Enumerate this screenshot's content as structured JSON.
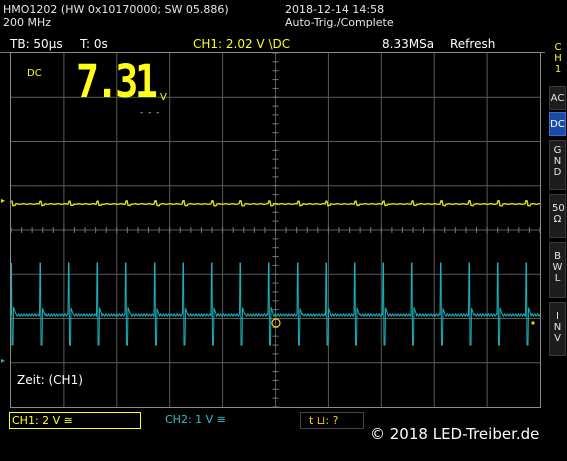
{
  "header": {
    "model": "HMO1202 (HW 0x10170000; SW 05.886)",
    "bandwidth": "200 MHz",
    "datetime": "2018-12-14 14:58",
    "trigger_status": "Auto-Trig./Complete"
  },
  "topbar": {
    "timebase": "TB: 50µs",
    "trigger_time": "T: 0s",
    "trigger_setting": "CH1: 2.02 V \\DC",
    "sample_rate": "8.33MSa",
    "mode": "Refresh"
  },
  "measurement": {
    "coupling": "DC",
    "value": "7.31",
    "unit": "V",
    "dashes": "- - -"
  },
  "screen_label": "Zeit: (CH1)",
  "channels": {
    "ch1": "CH1: 2 V ≅",
    "ch2": "CH2: 1 V ≅",
    "trig": "t ⊔: ?"
  },
  "copyright": "© 2018 LED-Treiber.de",
  "sidebar": {
    "title": "CH 1",
    "buttons": [
      {
        "label": "AC",
        "selected": false
      },
      {
        "label": "DC",
        "selected": true
      },
      {
        "label": "G N D",
        "selected": false
      },
      {
        "label": "50 Ω",
        "selected": false
      },
      {
        "label": "B W L",
        "selected": false
      },
      {
        "label": "I N V",
        "selected": false
      }
    ]
  },
  "colors": {
    "ch1": "#e8e000",
    "ch2": "#19b0b8",
    "ch1_label": "#ffff1a",
    "ch2_label": "#2fc3c8",
    "trigger_marker": "#ffd000"
  }
}
